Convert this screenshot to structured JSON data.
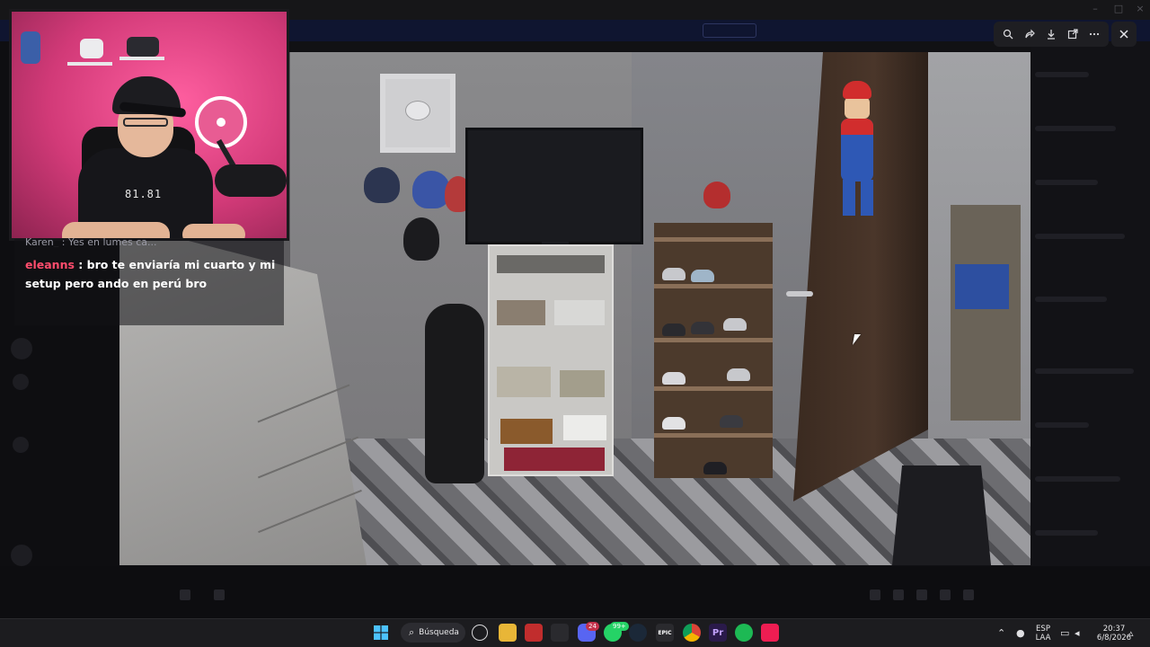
{
  "viewer": {
    "toolbar": {
      "zoom_icon": "zoom-icon",
      "share_icon": "share-icon",
      "download_icon": "download-icon",
      "open_icon": "open-external-icon",
      "more_icon": "more-icon"
    },
    "close_icon": "close-icon"
  },
  "chat": {
    "previous_line": "Karen_ : Yes en lumes ca...",
    "message": {
      "username": "eleanns",
      "separator": " : ",
      "text": "bro te enviaría mi cuarto y mi setup pero ando en perú bro"
    }
  },
  "webcam": {
    "shirt_text": "81.81"
  },
  "taskbar": {
    "search_label": "Búsqueda",
    "badges": {
      "discord": "24",
      "whatsapp": "99+"
    },
    "tray": {
      "lang_top": "ESP",
      "lang_bottom": "LAA",
      "time": "20:37",
      "date": "6/8/2026"
    }
  },
  "colors": {
    "chat_username": "#ff4d6d",
    "accent_pink": "#d6427a",
    "taskbar_bg": "#1c1c1f"
  }
}
